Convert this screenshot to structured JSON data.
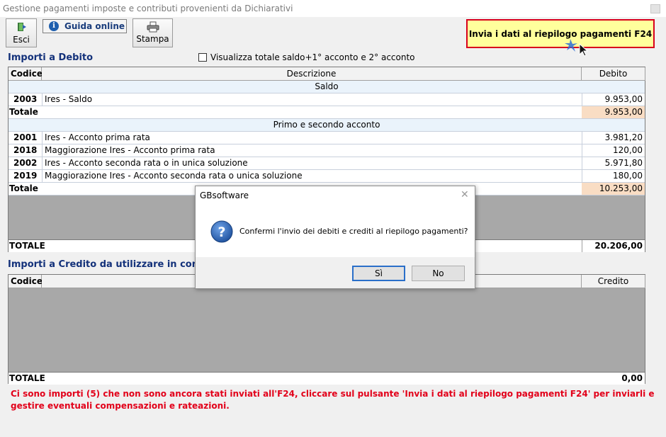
{
  "window": {
    "title": "Gestione pagamenti imposte e contributi provenienti da Dichiarativi"
  },
  "toolbar": {
    "esci_label": "Esci",
    "guida_label": "Guida online",
    "stampa_label": "Stampa",
    "invia_label": "Invia i dati al riepilogo pagamenti F24"
  },
  "debito": {
    "title": "Importi a Debito",
    "checkbox_label": "Visualizza totale saldo+1° acconto e 2° acconto",
    "columns": {
      "codice": "Codice",
      "descrizione": "Descrizione",
      "debito": "Debito"
    },
    "groups": [
      {
        "name": "Saldo",
        "rows": [
          {
            "codice": "2003",
            "descrizione": "Ires - Saldo",
            "importo": "9.953,00"
          }
        ],
        "total_label": "Totale",
        "total": "9.953,00"
      },
      {
        "name": "Primo e secondo acconto",
        "rows": [
          {
            "codice": "2001",
            "descrizione": "Ires - Acconto prima rata",
            "importo": "3.981,20"
          },
          {
            "codice": "2018",
            "descrizione": "Maggiorazione Ires - Acconto prima rata",
            "importo": "120,00"
          },
          {
            "codice": "2002",
            "descrizione": "Ires - Acconto seconda rata o in unica soluzione",
            "importo": "5.971,80"
          },
          {
            "codice": "2019",
            "descrizione": "Maggiorazione Ires - Acconto seconda rata o unica soluzione",
            "importo": "180,00"
          }
        ],
        "total_label": "Totale",
        "total": "10.253,00"
      }
    ],
    "grand_total_label": "TOTALE",
    "grand_total": "20.206,00"
  },
  "credito": {
    "title": "Importi a Credito da utilizzare in compens",
    "columns": {
      "codice": "Codice",
      "credito": "Credito"
    },
    "grand_total_label": "TOTALE",
    "grand_total": "0,00"
  },
  "warning": "Ci sono importi (5) che non sono ancora stati inviati all'F24, cliccare sul pulsante 'Invia i dati al riepilogo pagamenti F24' per inviarli e gestire eventuali compensazioni e rateazioni.",
  "dialog": {
    "title": "GBsoftware",
    "message": "Confermi l'invio dei debiti e crediti al riepilogo pagamenti?",
    "yes_label": "Sì",
    "no_label": "No"
  },
  "icons": {
    "exit": "exit-door-icon",
    "info": "info-icon",
    "print": "printer-icon",
    "question": "question-icon",
    "close": "close-icon",
    "cursor": "mouse-cursor-icon"
  },
  "colors": {
    "section_title": "#13317a",
    "invia_bg": "#ffff9c",
    "invia_border": "#d8001c",
    "warning": "#e2001a",
    "total_highlight": "#f9ddc4",
    "group_row": "#eaf3fb"
  }
}
